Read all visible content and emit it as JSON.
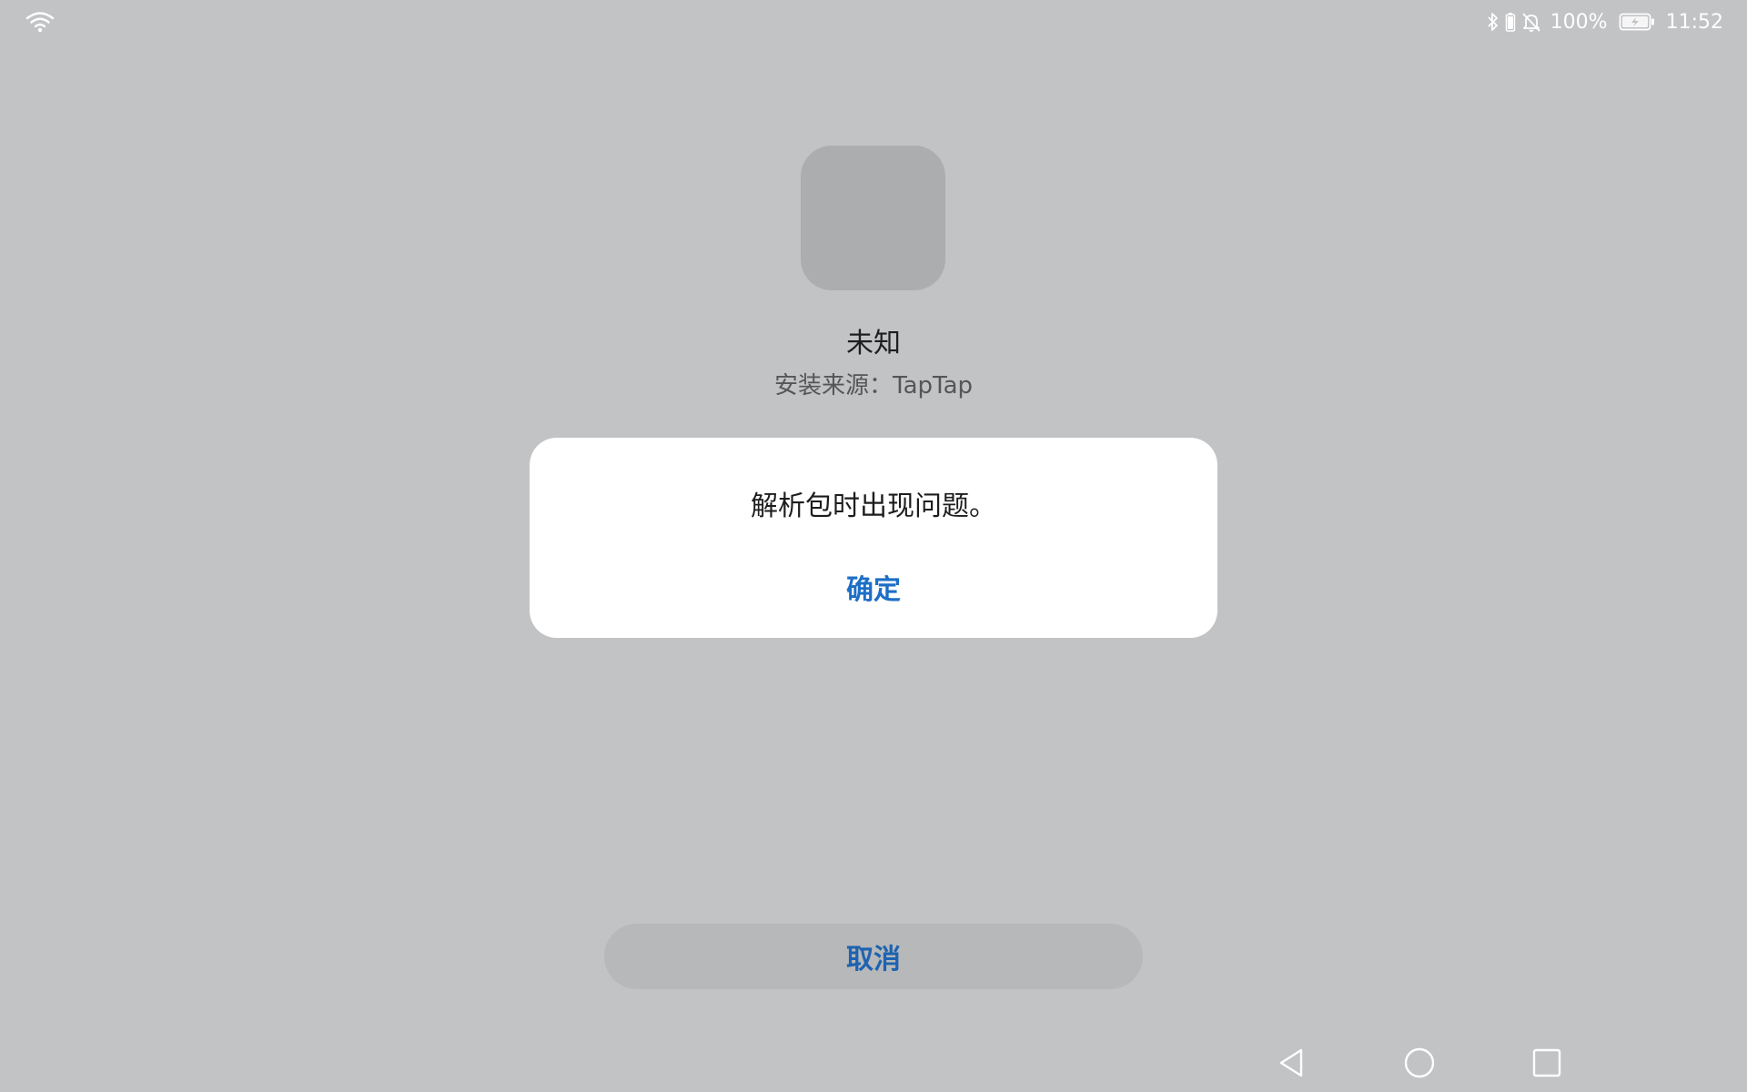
{
  "status_bar": {
    "battery_percent": "100%",
    "time": "11:52",
    "icons": [
      "wifi-icon",
      "bluetooth-icon",
      "battery-small-icon",
      "bell-off-icon",
      "battery-icon"
    ]
  },
  "app": {
    "name": "未知",
    "install_source": "安装来源：TapTap"
  },
  "dialog": {
    "message": "解析包时出现问题。",
    "confirm_label": "确定"
  },
  "footer": {
    "cancel_label": "取消"
  },
  "navigation": {
    "icons": [
      "back-icon",
      "home-icon",
      "recent-apps-icon"
    ]
  },
  "colors": {
    "background": "#c2c3c5",
    "accent": "#1d6fc6",
    "dialog_background": "#ffffff"
  }
}
